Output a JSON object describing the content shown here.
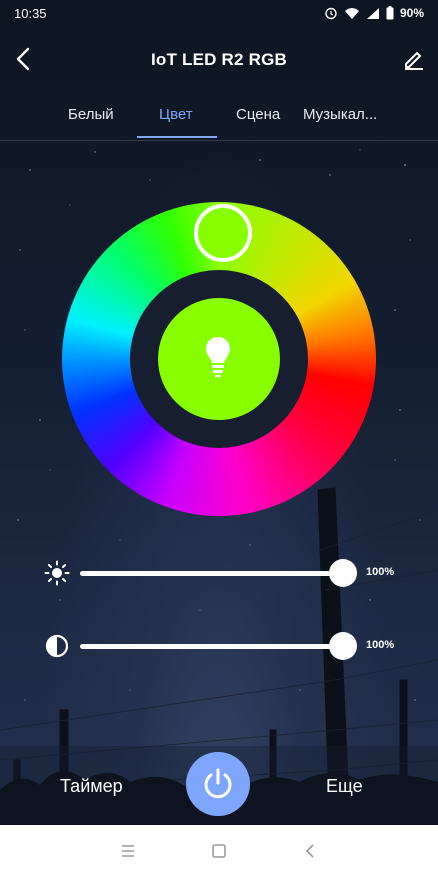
{
  "status_bar": {
    "time": "10:35",
    "battery": "90%",
    "icons": [
      "alarm-icon",
      "wifi-icon",
      "signal-icon",
      "battery-icon"
    ]
  },
  "app_bar": {
    "title": "IoT LED R2 RGB",
    "back_icon": "back-arrow-icon",
    "edit_icon": "pencil-icon"
  },
  "tabs": [
    {
      "label": "Белый",
      "active": false
    },
    {
      "label": "Цвет",
      "active": true
    },
    {
      "label": "Сцена",
      "active": false
    },
    {
      "label": "Музыкал...",
      "active": false
    }
  ],
  "color": {
    "selected": "#88ff00",
    "center_icon": "bulb-icon"
  },
  "sliders": {
    "brightness": {
      "value": "100%",
      "level": 1.0,
      "icon": "sun-icon"
    },
    "saturation": {
      "value": "100%",
      "level": 1.0,
      "icon": "contrast-icon"
    }
  },
  "bottom": {
    "timer_label": "Таймер",
    "more_label": "Еще",
    "power_icon": "power-icon",
    "power_color": "#7fa6ff"
  },
  "nav": {
    "menu_icon": "menu-icon",
    "home_icon": "home-icon",
    "back_icon": "back-icon"
  }
}
